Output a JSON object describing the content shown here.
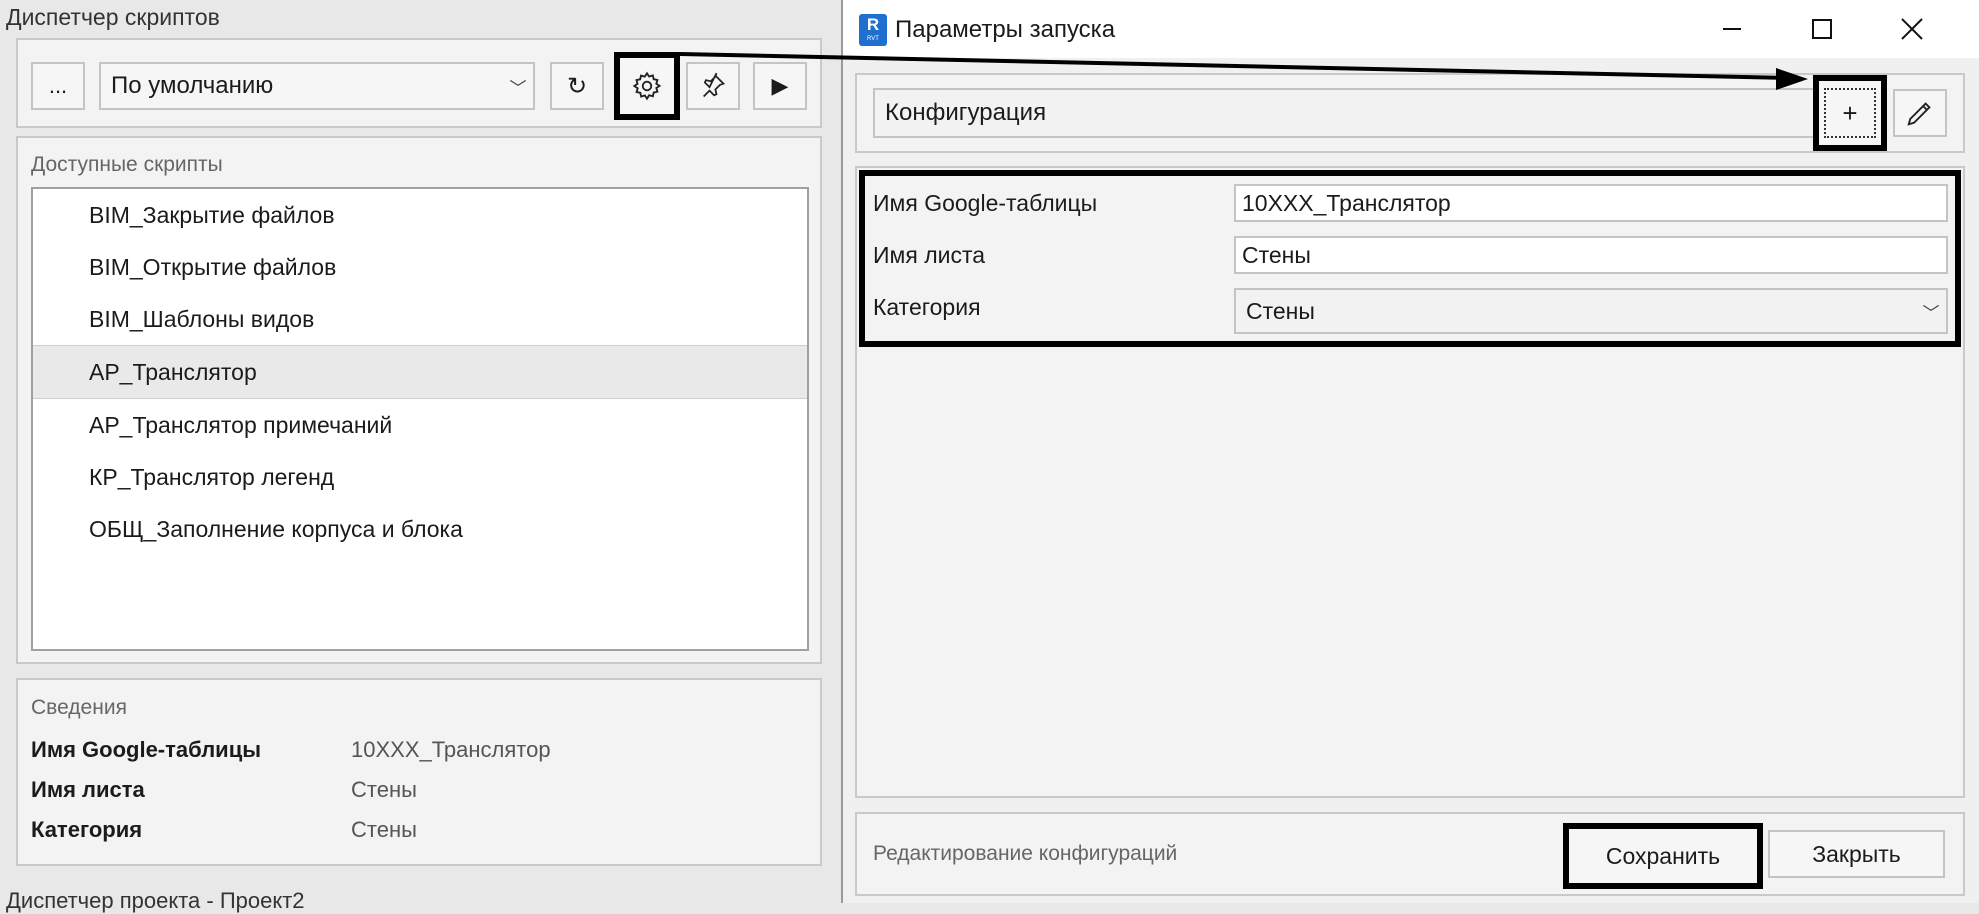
{
  "left": {
    "title": "Диспетчер скриптов",
    "toolbar": {
      "more_label": "...",
      "config_value": "По умолчанию",
      "refresh_glyph": "↻",
      "play_glyph": "▶"
    },
    "scripts": {
      "header": "Доступные скрипты",
      "items": [
        "BIM_Закрытие файлов",
        "BIM_Открытие файлов",
        "BIM_Шаблоны видов",
        "АР_Транслятор",
        "АР_Транслятор примечаний",
        "КР_Транслятор легенд",
        "ОБЩ_Заполнение корпуса и блока"
      ],
      "selected_index": 3
    },
    "info": {
      "header": "Сведения",
      "rows": [
        {
          "label": "Имя Google-таблицы",
          "value": "10XXX_Транслятор"
        },
        {
          "label": "Имя листа",
          "value": "Стены"
        },
        {
          "label": "Категория",
          "value": "Стены"
        }
      ]
    },
    "footer_text": "Диспетчер проекта - Проект2"
  },
  "dialog": {
    "app_icon_text": "R",
    "app_icon_sub": "RVT",
    "title": "Параметры запуска",
    "config": {
      "value": "Конфигурация",
      "add_glyph": "+"
    },
    "params": [
      {
        "label": "Имя Google-таблицы",
        "value": "10XXX_Транслятор",
        "kind": "text"
      },
      {
        "label": "Имя листа",
        "value": "Стены",
        "kind": "text"
      },
      {
        "label": "Категория",
        "value": "Стены",
        "kind": "select"
      }
    ],
    "status_text": "Редактирование конфигураций",
    "save_label": "Сохранить",
    "close_label": "Закрыть"
  },
  "colors": {
    "highlight": "#000000",
    "accent_icon": "#1f6fd1"
  }
}
